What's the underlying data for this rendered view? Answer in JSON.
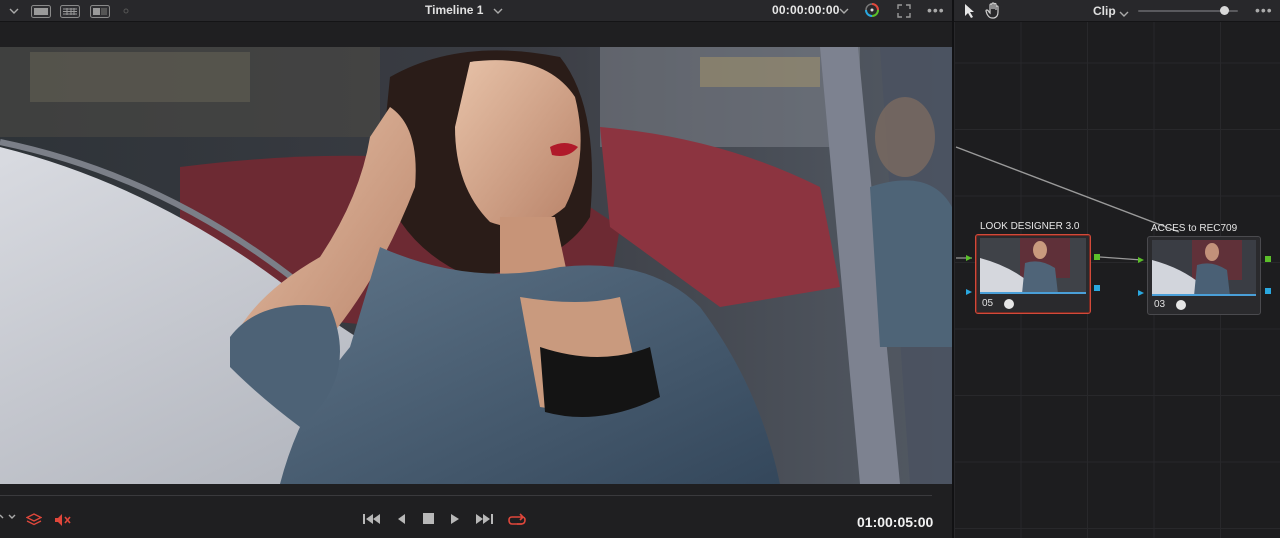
{
  "viewer": {
    "title": "Timeline 1",
    "timecode_top": "00:00:00:00",
    "timecode_bottom": "01:00:05:00",
    "menu_dots": "•••"
  },
  "nodes_panel": {
    "clip_label": "Clip",
    "zoom_level": 0.86,
    "menu_dots": "•••",
    "nodes": [
      {
        "label": "LOOK DESIGNER 3.0",
        "number": "05",
        "active": true
      },
      {
        "label": "ACCES to REC709",
        "number": "03",
        "active": false
      }
    ]
  },
  "colors": {
    "active_node_border": "#d24a3a",
    "output_port": "#5bbf2a",
    "input_port": "#2aa8e0",
    "record_icon": "#e0473b"
  },
  "icons": {
    "layout": [
      "single-viewer-icon",
      "grid-viewer-icon",
      "split-viewer-icon"
    ],
    "transport": [
      "skip-to-start-icon",
      "step-back-icon",
      "stop-icon",
      "play-icon",
      "skip-to-end-icon",
      "loop-icon"
    ],
    "node_tools": [
      "pointer-icon",
      "hand-icon"
    ]
  }
}
